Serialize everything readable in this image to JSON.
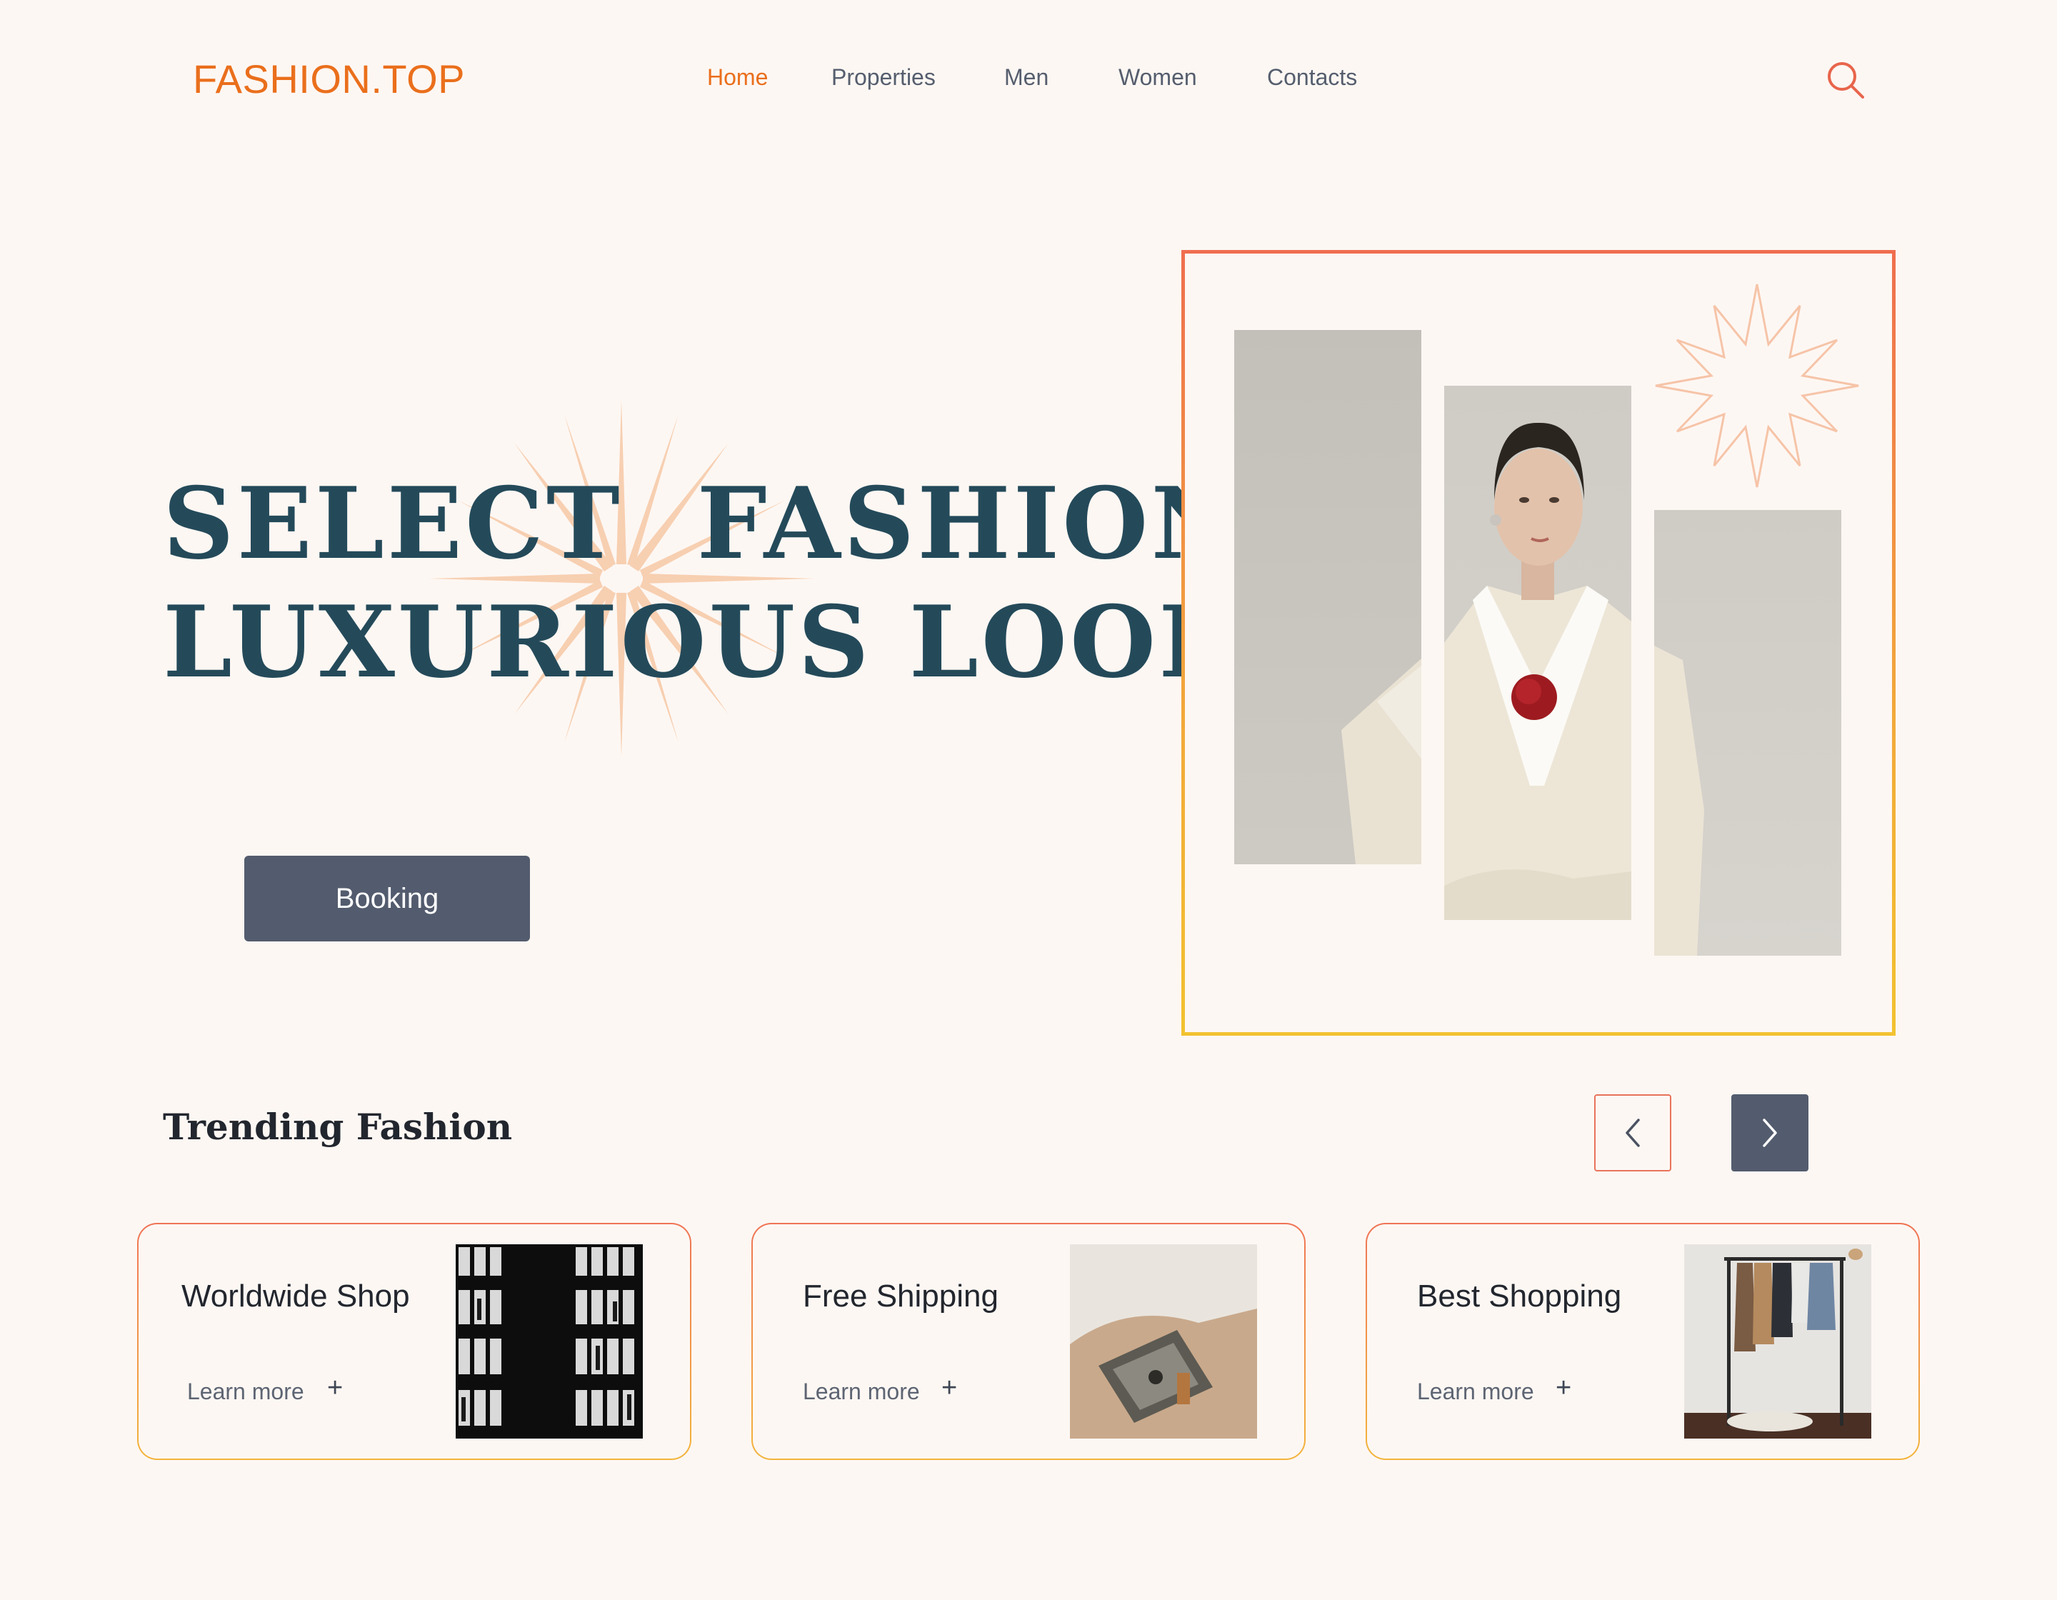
{
  "brand": {
    "logo": "FASHION.TOP",
    "accent": "#ea6f1c",
    "dark": "#244a5a",
    "button": "#535c6e"
  },
  "nav": {
    "items": [
      {
        "label": "Home",
        "active": true
      },
      {
        "label": "Properties",
        "active": false
      },
      {
        "label": "Men",
        "active": false
      },
      {
        "label": "Women",
        "active": false
      },
      {
        "label": "Contacts",
        "active": false
      }
    ],
    "search_icon": "search-icon"
  },
  "hero": {
    "title_line1": "SELECT  FASHION",
    "title_line2": "LUXURIOUS LOOKS",
    "cta": "Booking"
  },
  "trending": {
    "title": "Trending Fashion",
    "prev_icon": "chevron-left-icon",
    "next_icon": "chevron-right-icon",
    "cards": [
      {
        "title": "Worldwide Shop",
        "link": "Learn more",
        "plus": "+"
      },
      {
        "title": "Free Shipping",
        "link": "Learn more",
        "plus": "+"
      },
      {
        "title": "Best Shopping",
        "link": "Learn more",
        "plus": "+"
      }
    ]
  }
}
